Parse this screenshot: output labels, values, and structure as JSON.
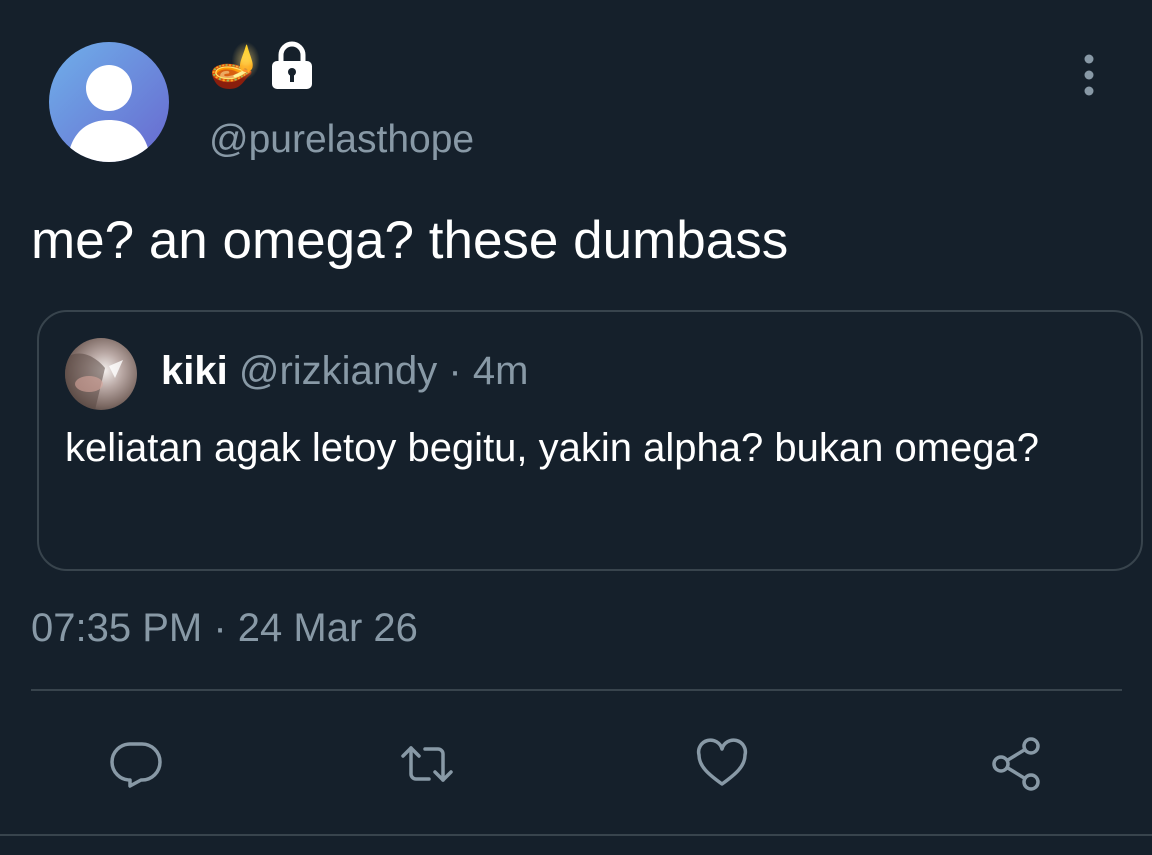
{
  "tweet": {
    "author": {
      "display_emojis": [
        "🪔",
        "🔒"
      ],
      "handle": "@purelasthope",
      "avatar": "default-user-icon"
    },
    "text": "me? an omega? these dumbass",
    "timestamp": "07:35 PM",
    "separator": "·",
    "date": "24 Mar 26"
  },
  "quote": {
    "name": "kiki",
    "handle": "@rizkiandy",
    "separator": "·",
    "time": "4m",
    "text": "keliatan agak letoy begitu, yakin alpha? bukan omega?",
    "avatar": "profile-photo"
  },
  "actions": [
    {
      "icon": "reply-icon"
    },
    {
      "icon": "retweet-icon"
    },
    {
      "icon": "like-icon"
    },
    {
      "icon": "share-icon"
    }
  ],
  "colors": {
    "background": "#15202b",
    "primary_text": "#ffffff",
    "secondary_text": "#8899a6",
    "border": "#38444d",
    "avatar_gradient_start": "#6aa9ea",
    "avatar_gradient_end": "#6a6ad0"
  }
}
